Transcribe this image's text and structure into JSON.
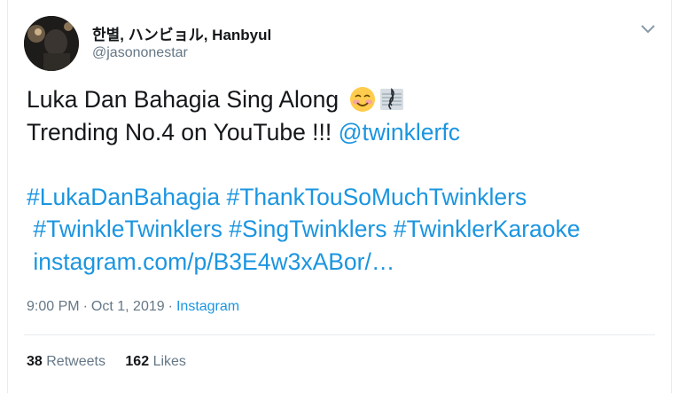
{
  "user": {
    "display_name": "한별, ハンビョル, Hanbyul",
    "handle": "@jasononestar",
    "avatar_icon": "avatar-photo"
  },
  "tweet": {
    "line1": "Luka Dan Bahagia Sing Along",
    "line2_prefix": "Trending No.4 on YouTube !!! ",
    "mention": "@twinklerfc",
    "hashtags": {
      "h1": "#LukaDanBahagia",
      "h2": "#ThankTouSoMuchTwinklers",
      "h3": "#TwinkleTwinklers",
      "h4": "#SingTwinklers",
      "h5": "#TwinklerKaraoke"
    },
    "url": "instagram.com/p/B3E4w3xABor/…",
    "emojis": [
      "smiling-face-emoji",
      "musical-score-emoji"
    ]
  },
  "meta": {
    "time": "9:00 PM",
    "date": "Oct 1, 2019",
    "separator": "·",
    "source": "Instagram"
  },
  "stats": {
    "retweets_count": "38",
    "retweets_label": "Retweets",
    "likes_count": "162",
    "likes_label": "Likes"
  },
  "colors": {
    "link": "#1b95e0",
    "muted": "#657786",
    "text": "#14171a",
    "border": "#e6ecf0"
  }
}
